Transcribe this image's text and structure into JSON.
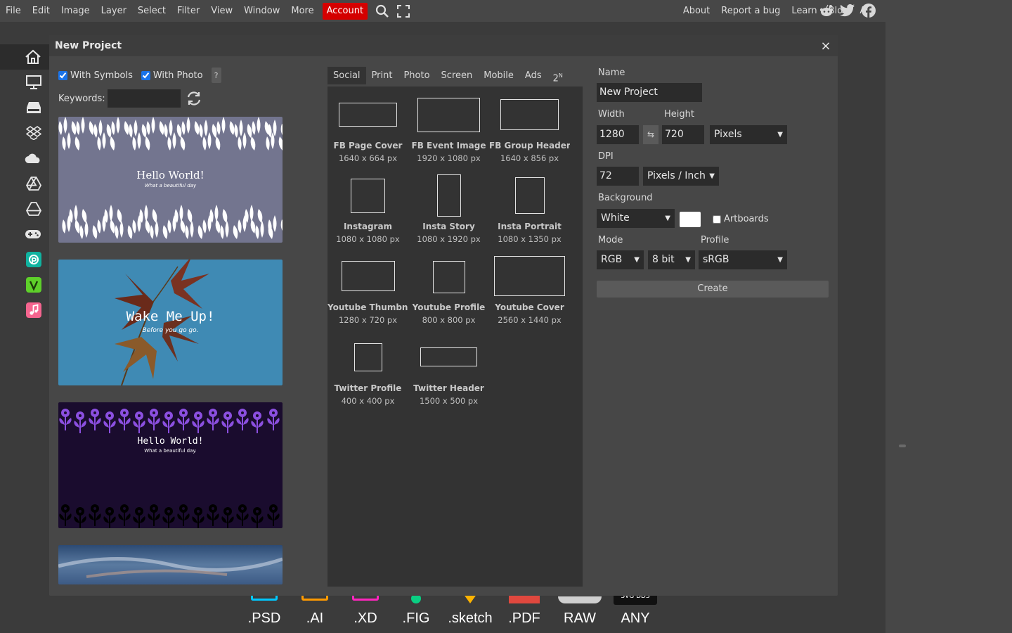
{
  "menubar": {
    "items": [
      "File",
      "Edit",
      "Image",
      "Layer",
      "Select",
      "Filter",
      "View",
      "Window",
      "More"
    ],
    "account": "Account",
    "right_links": [
      "About",
      "Report a bug",
      "Learn",
      "Blog",
      "API"
    ]
  },
  "dialog": {
    "title": "New Project",
    "close": "×",
    "with_symbols": "With Symbols",
    "with_photo": "With Photo",
    "help": "?",
    "keywords_label": "Keywords:",
    "keywords_value": "",
    "thumbs": [
      {
        "title": "Hello World!",
        "subtitle": "What a beautiful day"
      },
      {
        "title": "Wake Me Up!",
        "subtitle": "Before you go go."
      },
      {
        "title": "Hello World!",
        "subtitle": "What a beautiful day."
      },
      {
        "title": "",
        "subtitle": ""
      }
    ],
    "tabs": [
      "Social",
      "Print",
      "Photo",
      "Screen",
      "Mobile",
      "Ads"
    ],
    "tab_extra": "2",
    "tab_extra_sup": "N",
    "presets": [
      {
        "name": "FB Page Cover",
        "size": "1640 x 664 px"
      },
      {
        "name": "FB Event Image",
        "size": "1920 x 1080 px"
      },
      {
        "name": "FB Group Header",
        "size": "1640 x 856 px"
      },
      {
        "name": "Instagram",
        "size": "1080 x 1080 px"
      },
      {
        "name": "Insta Story",
        "size": "1080 x 1920 px"
      },
      {
        "name": "Insta Portrait",
        "size": "1080 x 1350 px"
      },
      {
        "name": "Youtube Thumbnail",
        "size": "1280 x 720 px"
      },
      {
        "name": "Youtube Profile",
        "size": "800 x 800 px"
      },
      {
        "name": "Youtube Cover",
        "size": "2560 x 1440 px"
      },
      {
        "name": "Twitter Profile",
        "size": "400 x 400 px"
      },
      {
        "name": "Twitter Header",
        "size": "1500 x 500 px"
      }
    ],
    "props": {
      "name_label": "Name",
      "name_value": "New Project",
      "width_label": "Width",
      "height_label": "Height",
      "width_value": "1280",
      "height_value": "720",
      "swap": "⇆",
      "unit": "Pixels",
      "dpi_label": "DPI",
      "dpi_value": "72",
      "dpi_unit": "Pixels / Inch",
      "bg_label": "Background",
      "bg_value": "White",
      "bg_color": "#ffffff",
      "artboards": "Artboards",
      "mode_label": "Mode",
      "profile_label": "Profile",
      "mode_value": "RGB",
      "bit_value": "8 bit",
      "profile_value": "sRGB",
      "create": "Create"
    }
  },
  "formats": [
    ".PSD",
    ".AI",
    ".XD",
    ".FIG",
    ".sketch",
    ".PDF",
    "RAW",
    "ANY"
  ],
  "colors": {
    "accent_red": "#d40000",
    "psd": "#00c8ff",
    "ai": "#ff9a00",
    "xd": "#ff26be",
    "fig": "#0acf83",
    "sketch": "#fdb300",
    "pdf": "#e0483e"
  }
}
